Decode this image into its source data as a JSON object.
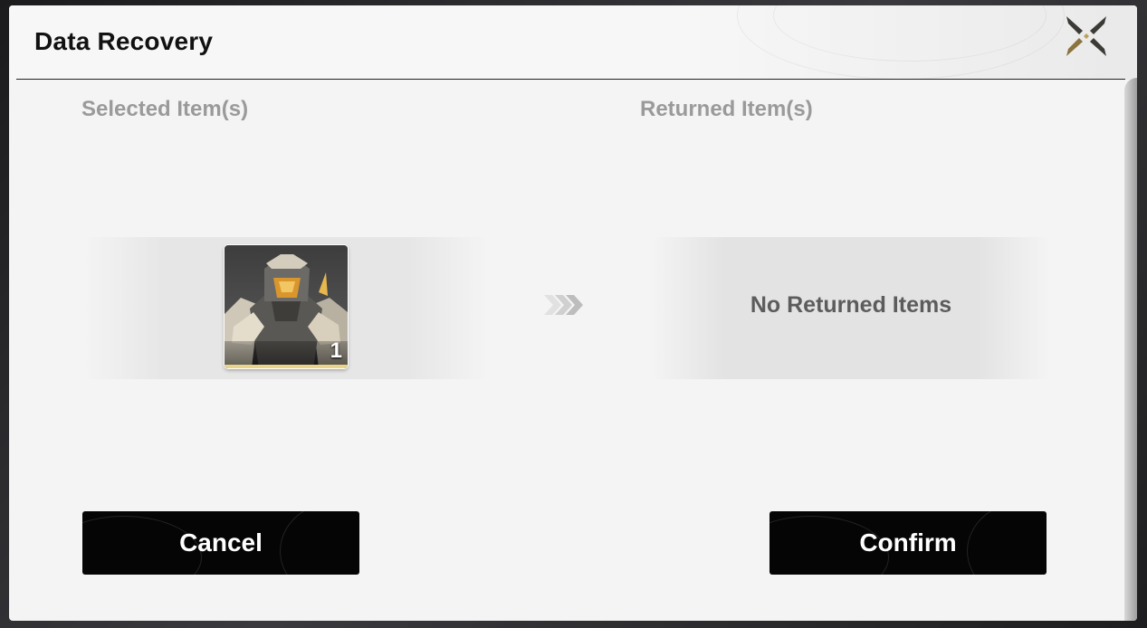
{
  "dialog": {
    "title": "Data Recovery",
    "close_icon": "close-x-icon"
  },
  "selected": {
    "label": "Selected Item(s)",
    "items": [
      {
        "icon": "armored-robot-item-icon",
        "count": "1"
      }
    ]
  },
  "arrow_icon": "triple-chevron-right-icon",
  "returned": {
    "label": "Returned Item(s)",
    "empty_text": "No Returned Items"
  },
  "buttons": {
    "cancel": "Cancel",
    "confirm": "Confirm"
  },
  "colors": {
    "dialog_background": "#f4f4f4",
    "button_background": "#050505",
    "section_label": "#9a9a9a",
    "accent_gold": "#c9a34a"
  }
}
